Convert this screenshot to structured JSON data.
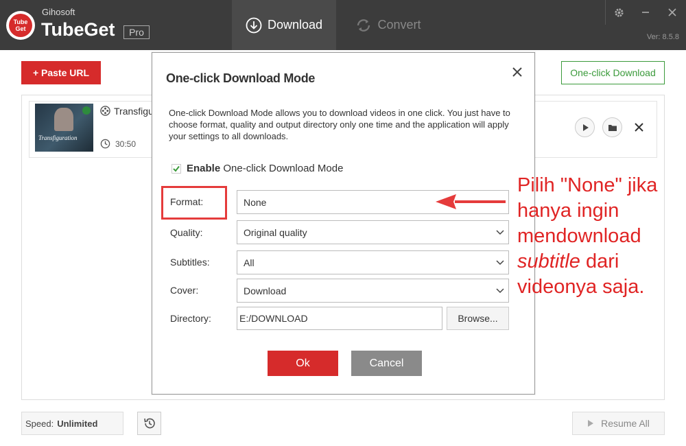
{
  "app": {
    "company": "Gihosoft",
    "name": "TubeGet",
    "edition": "Pro",
    "logo_text_top": "Tube",
    "logo_text_bottom": "Get",
    "version": "Ver: 8.5.8"
  },
  "tabs": [
    {
      "label": "Download",
      "icon": "download-icon",
      "active": true
    },
    {
      "label": "Convert",
      "icon": "convert-icon",
      "active": false
    }
  ],
  "toolbar": {
    "paste_label": "+ Paste URL",
    "oneclick_label": "One-click Download"
  },
  "download_item": {
    "title": "Transfigu",
    "duration": "30:50",
    "thumbnail_text": "Transfiguration"
  },
  "footer": {
    "speed_label": "Speed:",
    "speed_value": "Unlimited",
    "resume_label": "Resume All"
  },
  "dialog": {
    "title": "One-click Download Mode",
    "description": "One-click Download Mode allows you to download videos in one click.  You just have to choose format,  quality and output directory only one time and the application will apply your settings to all downloads.",
    "enable_bold": "Enable",
    "enable_rest": "One-click Download Mode",
    "enabled": true,
    "fields": {
      "format_label": "Format:",
      "format_value": "None",
      "quality_label": "Quality:",
      "quality_value": "Original quality",
      "subtitles_label": "Subtitles:",
      "subtitles_value": "All",
      "cover_label": "Cover:",
      "cover_value": "Download",
      "directory_label": "Directory:",
      "directory_value": "E:/DOWNLOAD"
    },
    "browse_label": "Browse...",
    "ok_label": "Ok",
    "cancel_label": "Cancel"
  },
  "annotation": {
    "line1": "Pilih \"None\" jika",
    "line2": "hanya ingin",
    "line3": "mendownload",
    "line4_italic": "subtitle",
    "line4_rest": " dari",
    "line5": "videonya saja."
  },
  "colors": {
    "header_bg": "#3c3c3c",
    "accent_red": "#d62b2b",
    "accent_green": "#3a9a3a",
    "annotation_red": "#e02424"
  }
}
